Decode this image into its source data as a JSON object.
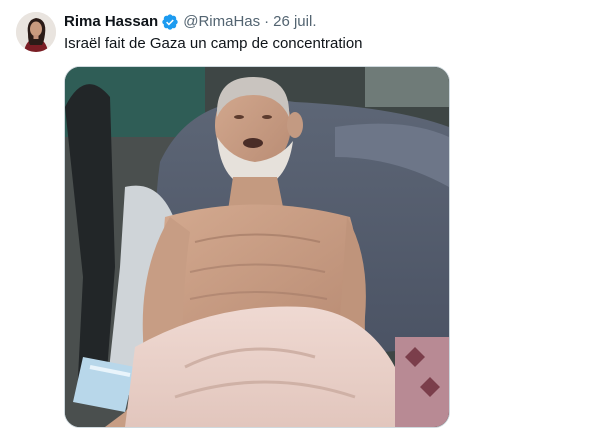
{
  "tweet": {
    "display_name": "Rima Hassan",
    "verified_icon": "verified-badge-icon",
    "handle": "@RimaHas",
    "separator": "·",
    "date": "26 juil.",
    "text": "Israël fait de Gaza un camp de concentration",
    "media_icon": "photo"
  },
  "colors": {
    "verified": "#1d9bf0",
    "secondary_text": "#536471",
    "primary_text": "#0f1419",
    "media_border": "#cfd9de"
  }
}
